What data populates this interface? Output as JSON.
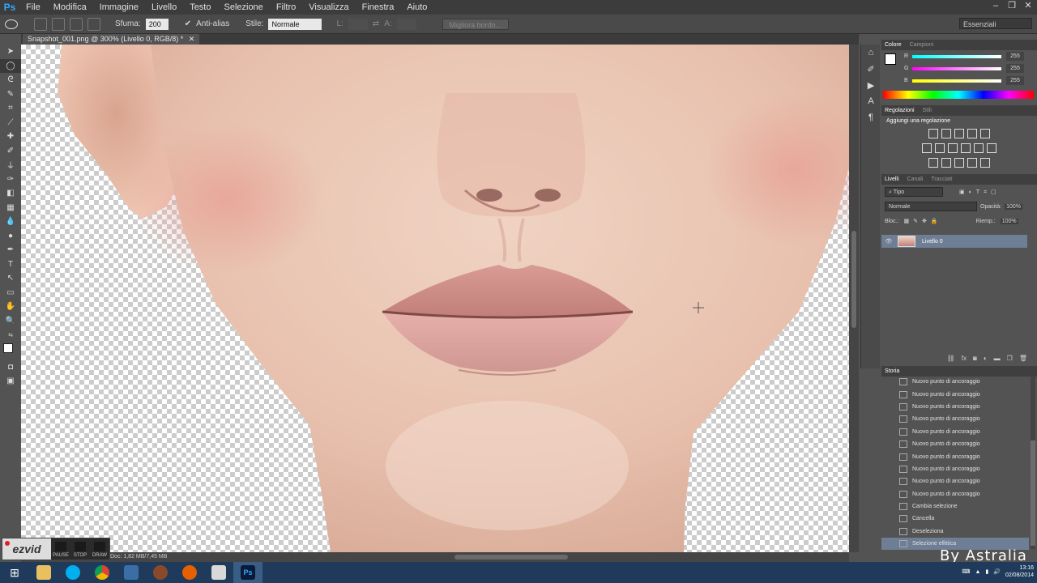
{
  "app": {
    "logo": "Ps"
  },
  "menu": [
    "File",
    "Modifica",
    "Immagine",
    "Livello",
    "Testo",
    "Selezione",
    "Filtro",
    "Visualizza",
    "Finestra",
    "Aiuto"
  ],
  "options": {
    "sfuma_label": "Sfuma:",
    "sfuma_value": "200 px",
    "antialias_label": "Anti-alias",
    "stile_label": "Stile:",
    "stile_value": "Normale",
    "l_label": "L:",
    "a_label": "A:",
    "refine_label": "Migliora bordo...",
    "workspace": "Essenziali"
  },
  "document": {
    "tab_title": "Snapshot_001.png @ 300% (Livello 0, RGB/8) *",
    "status": "Doc: 1,82 MB/7,45 MB"
  },
  "panels": {
    "color_tabs": [
      "Colore",
      "Campioni"
    ],
    "color": [
      {
        "ch": "R",
        "val": "255"
      },
      {
        "ch": "G",
        "val": "255"
      },
      {
        "ch": "B",
        "val": "255"
      }
    ],
    "adj_tabs": [
      "Regolazioni",
      "Stili"
    ],
    "adj_heading": "Aggiungi una regolazione",
    "layer_tabs": [
      "Livelli",
      "Canali",
      "Tracciati"
    ],
    "layer_kind": "Tipo",
    "blend_mode": "Normale",
    "opacity_label": "Opacità:",
    "opacity_value": "100%",
    "lock_label": "Bloc.:",
    "fill_label": "Riemp.:",
    "fill_value": "100%",
    "layer_name": "Livello 0",
    "history_tab": "Storia",
    "history": [
      "Nuovo punto di ancoraggio",
      "Nuovo punto di ancoraggio",
      "Nuovo punto di ancoraggio",
      "Nuovo punto di ancoraggio",
      "Nuovo punto di ancoraggio",
      "Nuovo punto di ancoraggio",
      "Nuovo punto di ancoraggio",
      "Nuovo punto di ancoraggio",
      "Nuovo punto di ancoraggio",
      "Nuovo punto di ancoraggio",
      "Cambia selezione",
      "Cancella",
      "Deseleziona",
      "Selezione ellittica"
    ]
  },
  "ezvid": {
    "logo": "ezvid",
    "pause": "PAUSE",
    "stop": "STOP",
    "draw": "DRAW"
  },
  "watermark": "By Astralia",
  "taskbar": {
    "time": "13:16",
    "date": "02/08/2014"
  }
}
